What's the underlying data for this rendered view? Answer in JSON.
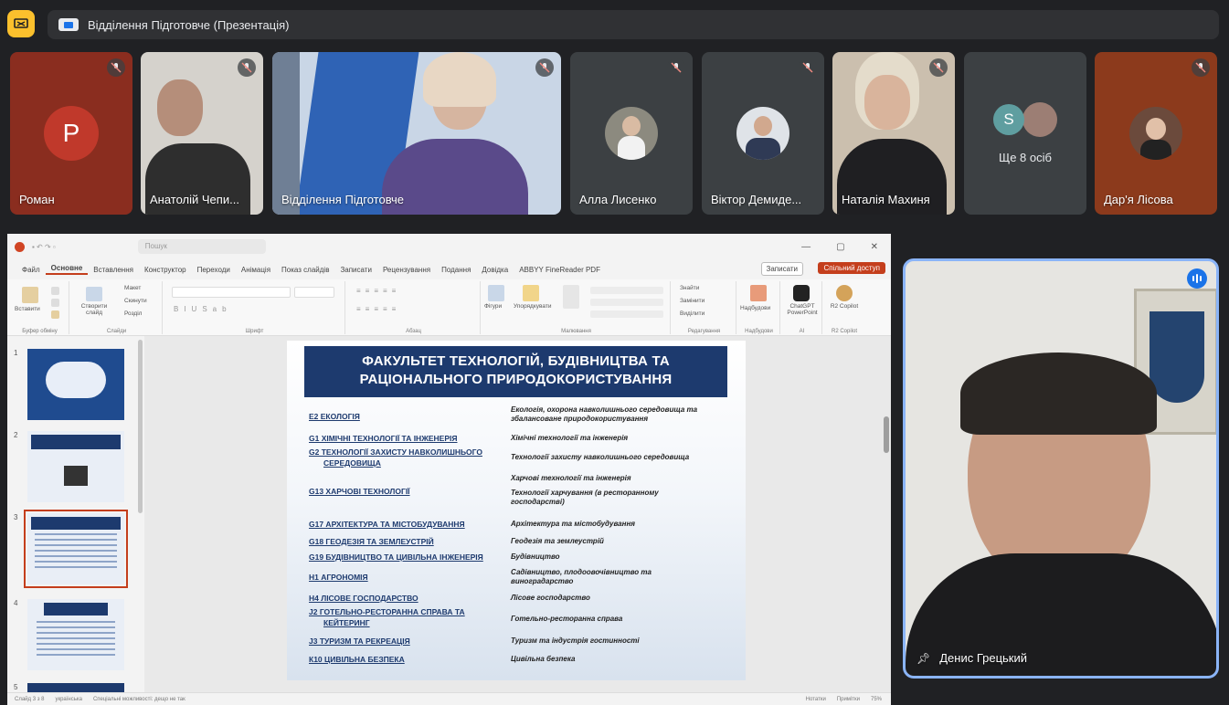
{
  "meeting": {
    "title": "Відділення Підготовче (Презентація)",
    "present_icon": "present-screen-icon"
  },
  "participants": [
    {
      "name": "Роман",
      "initial": "P",
      "muted": true
    },
    {
      "name": "Анатолій Чепи...",
      "muted": true
    },
    {
      "name": "Відділення Підготовче",
      "muted": true
    },
    {
      "name": "Алла Лисенко",
      "muted": true
    },
    {
      "name": "Віктор Демиде...",
      "muted": true
    },
    {
      "name": "Наталія Махиня",
      "muted": true
    },
    {
      "name": "Ще 8 осіб",
      "initial": "S"
    },
    {
      "name": "Дар'я Лісова",
      "muted": true
    }
  ],
  "speaker": {
    "name": "Денис Грецький"
  },
  "ppt": {
    "search": "Пошук",
    "menu": [
      "Файл",
      "Основне",
      "Вставлення",
      "Конструктор",
      "Переходи",
      "Анімація",
      "Показ слайдів",
      "Записати",
      "Рецензування",
      "Подання",
      "Довідка",
      "ABBYY FineReader PDF"
    ],
    "active_menu": "Основне",
    "record_button": "Записати",
    "share_button": "Спільний доступ",
    "ribbon_groups": [
      "Буфер обміну",
      "Слайди",
      "Шрифт",
      "Абзац",
      "Малювання",
      "Редагування",
      "Надбудови",
      "AI",
      "R2 Copilot"
    ],
    "ribbon_buttons": {
      "paste": "Вставити",
      "new_slide": "Створити слайд",
      "layout": "Макет",
      "reset": "Скинути",
      "section": "Розділ",
      "shapes": "Фігури",
      "arrange": "Упорядкувати",
      "find": "Знайти",
      "replace": "Замінити",
      "select": "Виділити",
      "addins": "Надбудови",
      "chatgpt": "ChatGPT PowerPoint",
      "copilot": "R2 Copilot"
    },
    "thumb_numbers": [
      "1",
      "2",
      "3",
      "4",
      "5"
    ],
    "selected_thumb": 3,
    "status_left": [
      "Слайд 3 з 8",
      "українська",
      "Спеціальні можливості: дещо не так"
    ],
    "status_right": [
      "Нотатки",
      "Примітки",
      "75%"
    ],
    "slide": {
      "title_line1": "ФАКУЛЬТЕТ ТЕХНОЛОГІЙ, БУДІВНИЦТВА ТА",
      "title_line2": "РАЦІОНАЛЬНОГО ПРИРОДОКОРИСТУВАННЯ",
      "rows": [
        {
          "code": "Е2 ЕКОЛОГІЯ",
          "desc": "Екологія, охорона навколишнього середовища та збалансоване природокористування"
        },
        {
          "code": "G1 ХІМІЧНІ ТЕХНОЛОГІЇ ТА ІНЖЕНЕРІЯ",
          "desc": "Хімічні технології та інженерія"
        },
        {
          "code": "G2 ТЕХНОЛОГІЇ ЗАХИСТУ НАВКОЛИШНЬОГО",
          "code2": "СЕРЕДОВИЩА",
          "desc": "Технології захисту навколишнього середовища"
        },
        {
          "code": "",
          "desc": "Харчові технології та інженерія"
        },
        {
          "code": "G13 ХАРЧОВІ ТЕХНОЛОГІЇ",
          "desc": "Технології харчування (в ресторанному господарстві)"
        },
        {
          "code": "G17 АРХІТЕКТУРА ТА МІСТОБУДУВАННЯ",
          "desc": "Архітектура та містобудування"
        },
        {
          "code": "G18 ГЕОДЕЗІЯ ТА ЗЕМЛЕУСТРІЙ",
          "desc": "Геодезія та землеустрій"
        },
        {
          "code": "G19 БУДІВНИЦТВО ТА ЦИВІЛЬНА ІНЖЕНЕРІЯ",
          "desc": "Будівництво"
        },
        {
          "code": "Н1 АГРОНОМІЯ",
          "desc": "Садівництво, плодоовочівництво та виноградарство"
        },
        {
          "code": "Н4 ЛІСОВЕ ГОСПОДАРСТВО",
          "desc": "Лісове господарство"
        },
        {
          "code": "J2 ГОТЕЛЬНО-РЕСТОРАННА СПРАВА ТА",
          "code2": "КЕЙТЕРИНГ",
          "desc": "Готельно-ресторанна справа"
        },
        {
          "code": "J3 ТУРИЗМ ТА РЕКРЕАЦІЯ",
          "desc": "Туризм та індустрія гостинності"
        },
        {
          "code": "К10 ЦИВІЛЬНА БЕЗПЕКА",
          "desc": "Цивільна безпека"
        }
      ]
    }
  },
  "colors": {
    "accent": "#1a73e8",
    "slide_header": "#1d3a6e",
    "ppt_red": "#c43e1c",
    "present": "#fbc02d"
  }
}
